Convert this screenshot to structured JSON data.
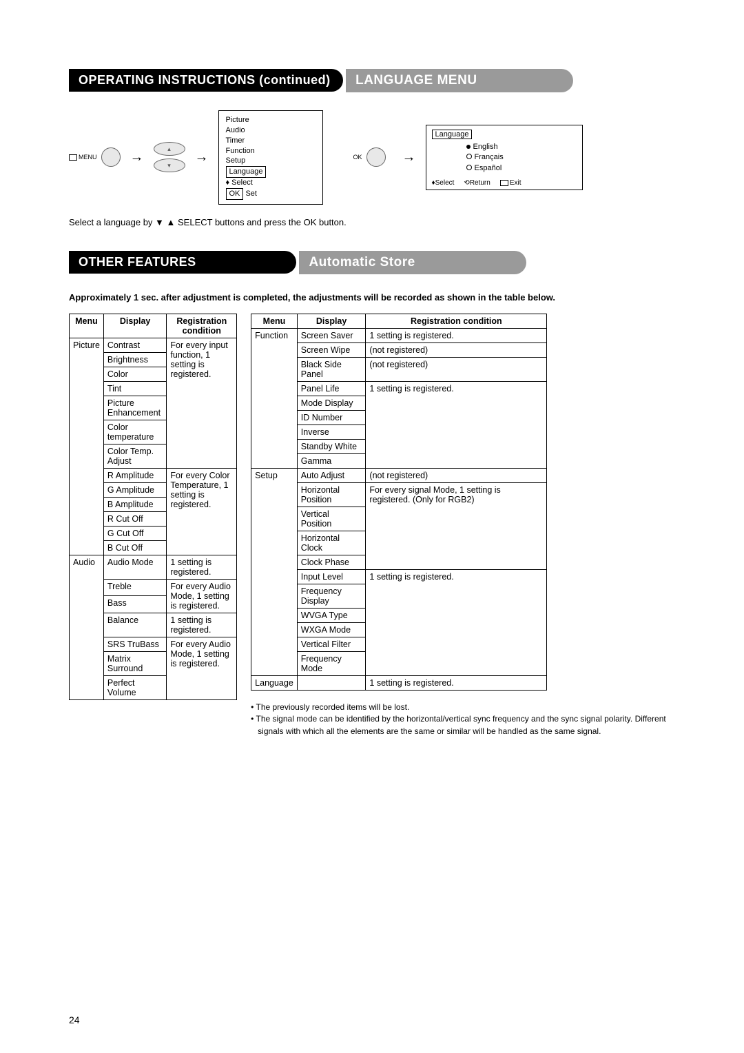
{
  "heading1": "OPERATING INSTRUCTIONS (continued)",
  "heading2": "LANGUAGE MENU",
  "heading3": "OTHER FEATURES",
  "heading4": "Automatic Store",
  "flow": {
    "menu_label": "MENU",
    "ok_label": "OK",
    "osd_menu": {
      "items": [
        "Picture",
        "Audio",
        "Timer",
        "Function",
        "Setup"
      ],
      "highlight": "Language",
      "select": "Select",
      "set": "Set",
      "ok": "OK"
    },
    "osd_lang": {
      "header": "Language",
      "opt1": "English",
      "opt2": "Français",
      "opt3": "Español",
      "select": "Select",
      "return": "Return",
      "exit": "Exit"
    }
  },
  "instruction": "Select a language by ▼ ▲ SELECT buttons and press the OK button.",
  "boldnote": "Approximately 1 sec. after adjustment is completed, the adjustments will be recorded as shown in the table below.",
  "table": {
    "h_menu": "Menu",
    "h_display": "Display",
    "h_cond": "Registration condition"
  },
  "left": {
    "picture": "Picture",
    "audio": "Audio",
    "contrast": "Contrast",
    "brightness": "Brightness",
    "color": "Color",
    "tint": "Tint",
    "pic_enh": "Picture Enhancement",
    "ctemp": "Color temperature",
    "ctemp_adj": "Color Temp. Adjust",
    "r_amp": "R Amplitude",
    "g_amp": "G Amplitude",
    "b_amp": "B Amplitude",
    "r_cut": "R Cut Off",
    "g_cut": "G Cut Off",
    "b_cut": "B Cut Off",
    "input_cond": "For every input function, 1 setting is registered.",
    "ctemp_cond": "For every Color Temperature, 1 setting is registered.",
    "audio_mode": "Audio Mode",
    "treble": "Treble",
    "bass": "Bass",
    "balance": "Balance",
    "srs": "SRS TruBass",
    "matrix": "Matrix Surround",
    "perfect": "Perfect Volume",
    "one_setting": "1 setting is registered.",
    "audio_cond": "For every Audio Mode, 1 setting is registered."
  },
  "right": {
    "function": "Function",
    "setup": "Setup",
    "language": "Language",
    "screen_saver": "Screen Saver",
    "screen_wipe": "Screen Wipe",
    "bsp": "Black Side Panel",
    "panel_life": "Panel Life",
    "mode_disp": "Mode Display",
    "id_num": "ID Number",
    "inverse": "Inverse",
    "standby": "Standby White",
    "gamma": "Gamma",
    "auto_adj": "Auto Adjust",
    "hpos": "Horizontal Position",
    "vpos": "Vertical Position",
    "hclock": "Horizontal Clock",
    "cphase": "Clock Phase",
    "input_level": "Input Level",
    "freq_disp": "Frequency Display",
    "wvga": "WVGA Type",
    "wxga": "WXGA Mode",
    "vfilter": "Vertical Filter",
    "freq_mode": "Frequency Mode",
    "one_setting": "1 setting is registered.",
    "not_reg": "(not registered)",
    "signal_cond": "For every signal Mode, 1 setting is registered. (Only for RGB2)"
  },
  "footnotes": {
    "n1": "• The previously recorded items will be lost.",
    "n2": "• The signal mode can be identified by the horizontal/vertical sync frequency and the sync signal polarity. Different signals with which all the elements are the same or similar will be handled as the same signal."
  },
  "page_number": "24"
}
